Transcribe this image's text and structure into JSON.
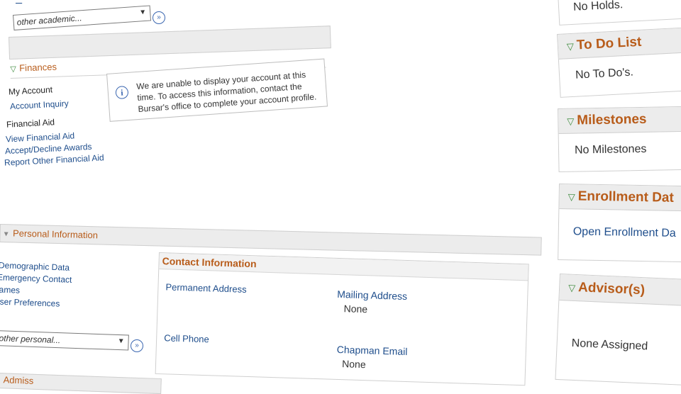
{
  "top_fragment": "",
  "academics": {
    "select_value": "other academic..."
  },
  "finances": {
    "title": "Finances",
    "my_account": "My Account",
    "account_inquiry": "Account Inquiry",
    "financial_aid": "Financial Aid",
    "view_financial_aid": "View Financial Aid",
    "accept_decline": "Accept/Decline Awards",
    "report_other": "Report Other Financial Aid",
    "info_message": [
      "We are unable to display your account at this",
      "time.  To access this information, contact the",
      "Bursar's office to complete your account profile."
    ]
  },
  "personal": {
    "title": "Personal Information",
    "links": [
      "Demographic Data",
      "Emergency Contact",
      "Names",
      "User Preferences"
    ],
    "select_value": "other personal...",
    "contact_title": "Contact Information",
    "permanent_address": "Permanent Address",
    "mailing_address": "Mailing Address",
    "mailing_value": "None",
    "cell_phone": "Cell Phone",
    "chapman_email": "Chapman Email",
    "email_value": "None"
  },
  "admission_fragment": "Admiss",
  "right_panel": {
    "holds_body": "No Holds.",
    "todo_title": "To Do List",
    "todo_body": "No To Do's.",
    "milestones_title": "Milestones",
    "milestones_body": "No Milestones",
    "enrollment_title": "Enrollment Dat",
    "enrollment_link": "Open Enrollment Da",
    "advisors_title": "Advisor(s)",
    "advisors_body": "None Assigned"
  },
  "colors": {
    "accent": "#b85c1a",
    "link": "#1f4e8c",
    "triangle": "#3c8a3c"
  }
}
